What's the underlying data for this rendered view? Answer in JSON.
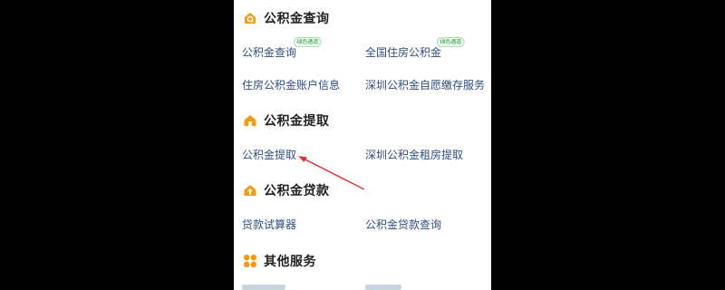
{
  "colors": {
    "accent": "#f39c12",
    "link": "#2f4f7f",
    "badge_green": "#2e9a3a",
    "annotation": "#d9363e"
  },
  "sections": [
    {
      "icon": "house-search-icon",
      "title": "公积金查询",
      "items": [
        {
          "label": "公积金查询",
          "badge": "绿色通道"
        },
        {
          "label": "全国住房公积金",
          "badge": "绿色通道"
        },
        {
          "label": "住房公积金账户信息"
        },
        {
          "label": "深圳公积金自愿缴存服务"
        }
      ]
    },
    {
      "icon": "house-icon",
      "title": "公积金提取",
      "items": [
        {
          "label": "公积金提取"
        },
        {
          "label": "深圳公积金租房提取"
        }
      ]
    },
    {
      "icon": "house-upload-icon",
      "title": "公积金贷款",
      "items": [
        {
          "label": "贷款试算器"
        },
        {
          "label": "公积金贷款查询"
        }
      ]
    },
    {
      "icon": "grid-icon",
      "title": "其他服务",
      "items": []
    }
  ]
}
